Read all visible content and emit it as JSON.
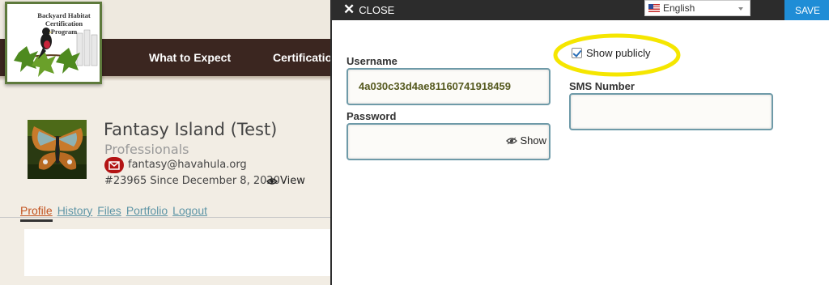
{
  "site": {
    "logo_lines": [
      "Backyard Habitat",
      "Certification",
      "Program"
    ],
    "nav": [
      "What to Expect",
      "Certification"
    ]
  },
  "profile": {
    "name": "Fantasy Island (Test)",
    "role": "Professionals",
    "email": "fantasy@havahula.org",
    "since": "#23965 Since December 8, 2020",
    "view_label": "View",
    "tabs": [
      "Profile",
      "History",
      "Files",
      "Portfolio",
      "Logout"
    ],
    "active_tab": "Profile"
  },
  "modal": {
    "close_label": "CLOSE",
    "language": "English",
    "save_label": "SAVE",
    "username_label": "Username",
    "username_value": "4a030c33d4ae81160741918459",
    "password_label": "Password",
    "password_value": "",
    "show_password_label": "Show",
    "show_publicly_label": "Show publicly",
    "show_publicly_checked": true,
    "sms_label": "SMS Number",
    "sms_value": "",
    "highlight_color": "#f5e600"
  },
  "colors": {
    "nav_bg": "#3b2620",
    "save_bg": "#1f8dd6",
    "tab_link": "#5e95a6",
    "tab_active": "#c2531f",
    "mail_badge": "#b31414"
  }
}
